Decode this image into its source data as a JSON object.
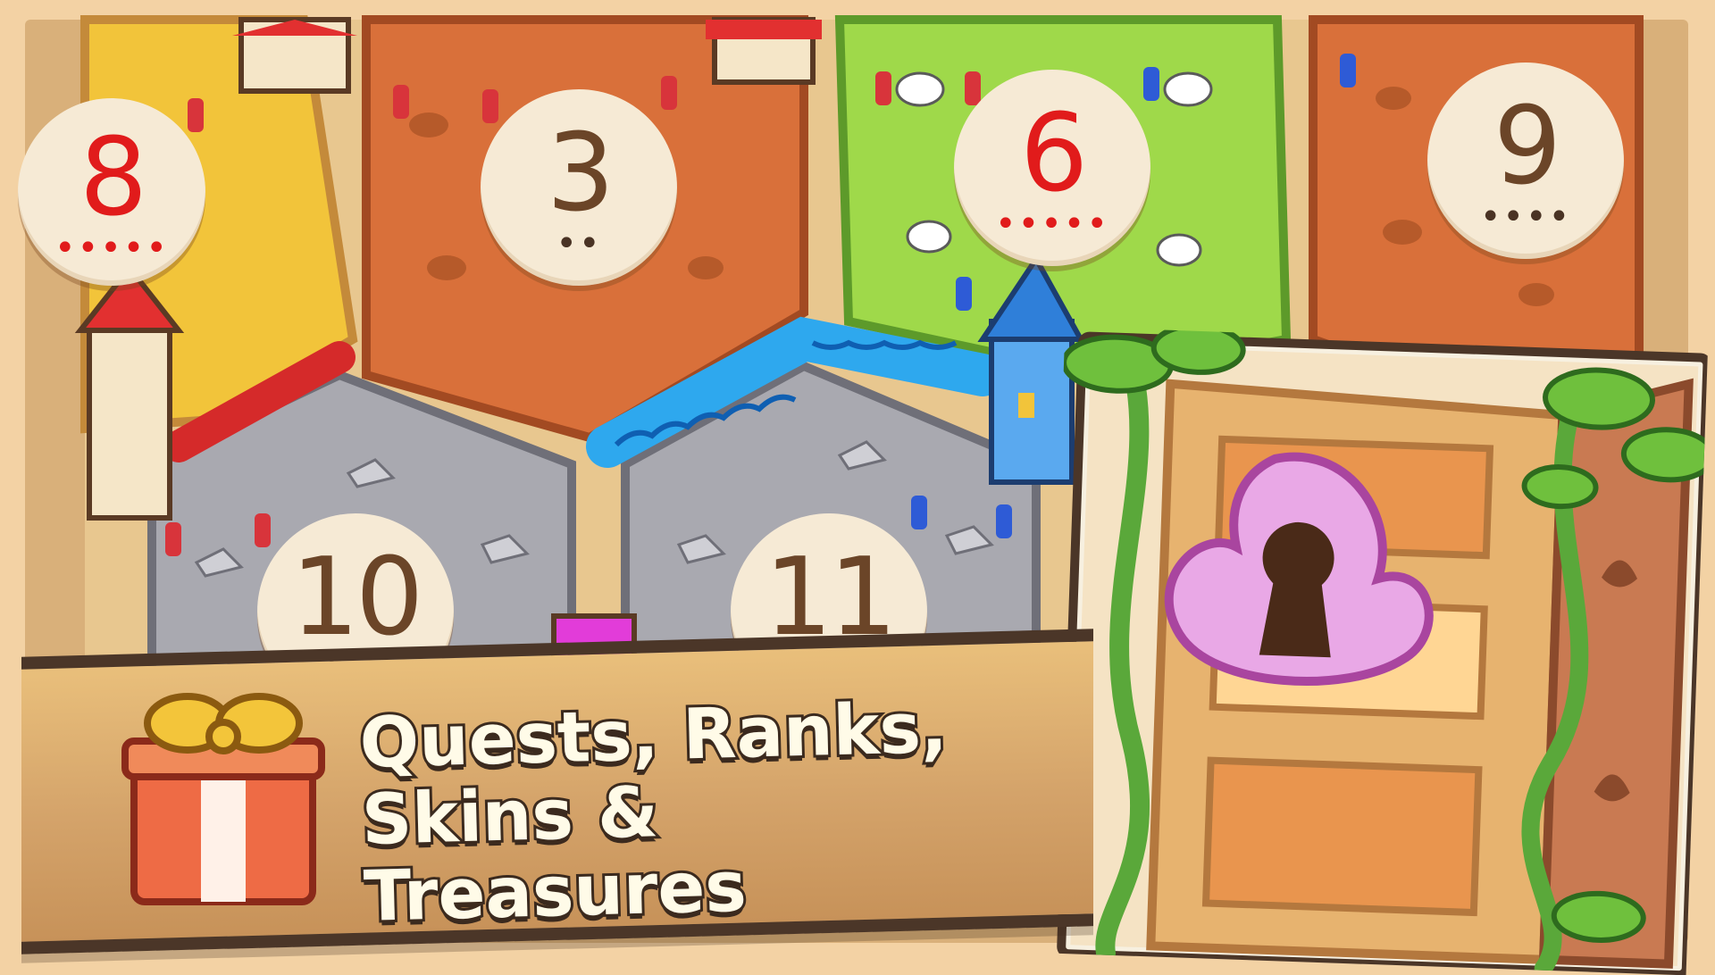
{
  "banner": {
    "line1": "Quests, Ranks,",
    "line2": "Skins & Treasures"
  },
  "tokens": [
    {
      "number": "8",
      "dots": "•••••"
    },
    {
      "number": "3",
      "dots": "••"
    },
    {
      "number": "6",
      "dots": "•••••"
    },
    {
      "number": "9",
      "dots": "••••"
    },
    {
      "number": "10",
      "dots": "•••"
    },
    {
      "number": "11",
      "dots": "••"
    }
  ],
  "colors": {
    "frame": "#f3d2a4",
    "desert": "#d9703a",
    "field": "#f2c43a",
    "pasture": "#9fd94a",
    "mountain": "#a9a9b0",
    "water": "#2ea8ee",
    "banner_text": "#fffbe8",
    "banner_outline": "#3b2a1e",
    "chest_lock": "#e9a8e6",
    "red_number": "#e11b1b"
  },
  "icons": [
    "gift-box-icon",
    "keyhole-lock-icon",
    "treasure-chest-icon",
    "sheep-icon",
    "worker-icon",
    "house-icon",
    "tower-icon"
  ]
}
